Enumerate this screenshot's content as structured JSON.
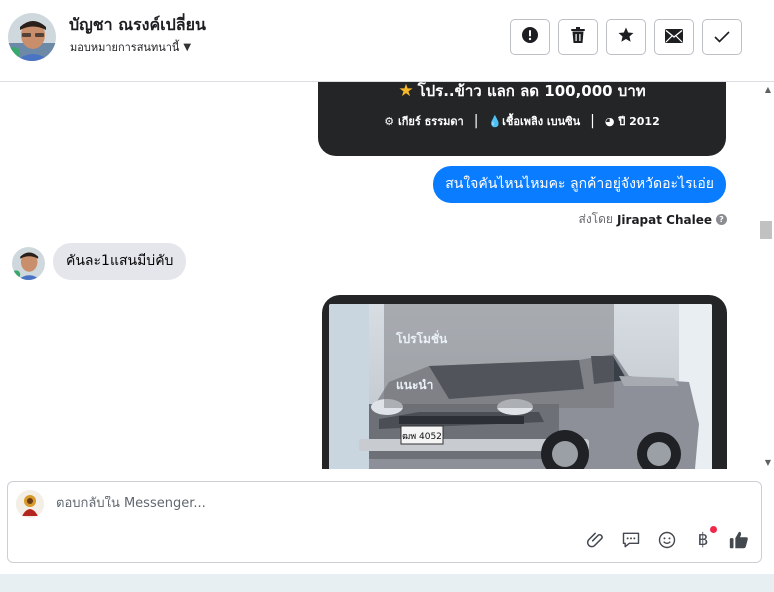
{
  "header": {
    "contact_name": "บัญชา ณรงค์เปลี่ยน",
    "assign_label": "มอบหมายการสนทนานี้",
    "buttons": [
      {
        "name": "mark-spam-button",
        "icon": "exclamation-icon"
      },
      {
        "name": "delete-button",
        "icon": "trash-icon"
      },
      {
        "name": "star-button",
        "icon": "star-icon"
      },
      {
        "name": "mark-unread-button",
        "icon": "envelope-icon"
      },
      {
        "name": "mark-done-button",
        "icon": "checkmark-icon"
      }
    ]
  },
  "conversation": {
    "promo_card": {
      "title": "โปร..ข้าว แลก ลด 100,000 บาท",
      "gear": "เกียร์ ธรรมดา",
      "fuel": "เชื้อเพลิง เบนซิน",
      "year": "ปี 2012"
    },
    "outgoing_message": "สนใจคันไหนไหมคะ ลูกค้าอยู่จังหวัดอะไรเอ่ย",
    "sent_by_prefix": "ส่งโดย",
    "sent_by_name": "Jirapat Chalee",
    "incoming_message": "คันละ1แสนมีบ่คับ",
    "image_card": {
      "promo_line1": "โปรโมชั่น",
      "promo_line2": "แนะนำ",
      "plate": "ฒพ 4052"
    }
  },
  "reply": {
    "placeholder": "ตอบกลับใน Messenger...",
    "tools": [
      "attachment-icon",
      "saved-replies-icon",
      "emoji-icon",
      "baht-payment-icon",
      "thumbs-up-icon"
    ]
  },
  "colors": {
    "outgoing_bubble": "#0a7cff",
    "incoming_bubble": "#e4e6eb",
    "card_dark": "#242526",
    "star": "#f7b928",
    "notification_dot": "#f02849"
  }
}
